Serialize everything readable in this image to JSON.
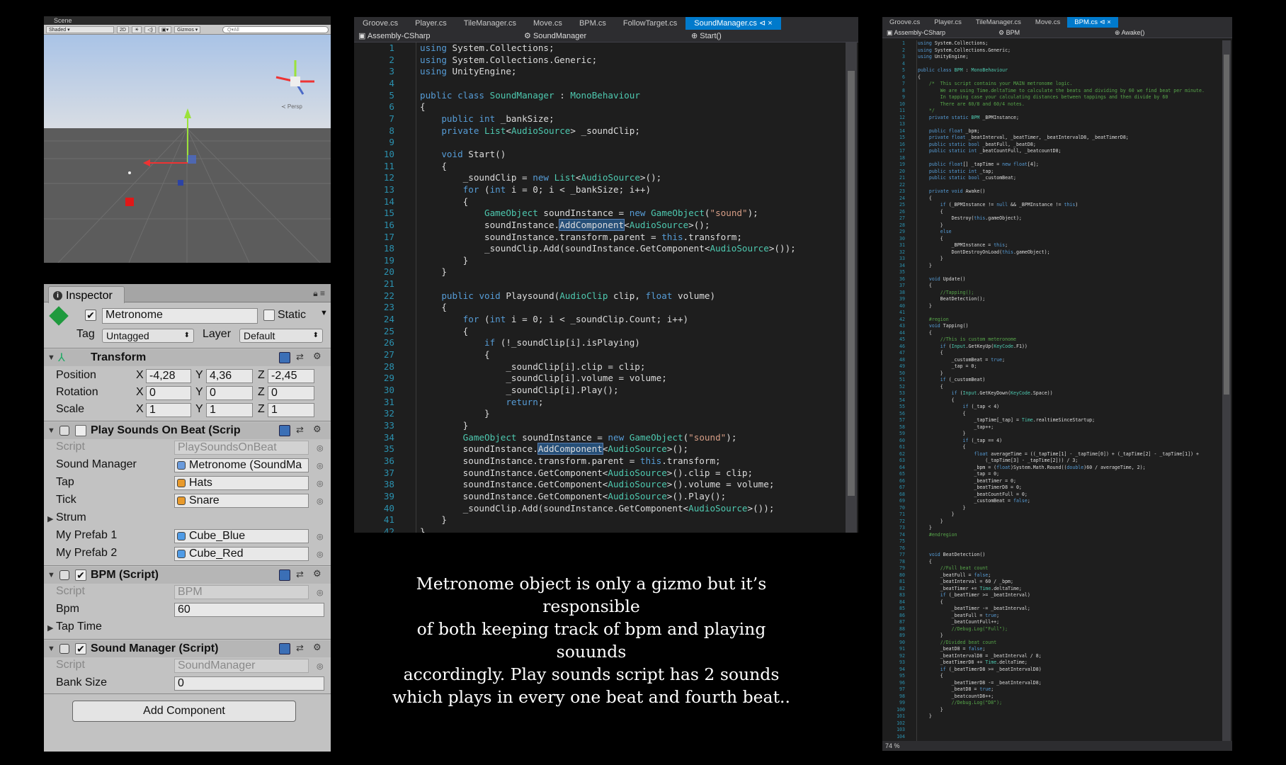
{
  "scene": {
    "tab": "Scene",
    "toolbar": {
      "shading": "Shaded",
      "mode2d": "2D",
      "gizmos": "Gizmos",
      "search_placeholder": "Q▾All"
    },
    "persp_label": "≺ Persp"
  },
  "inspector": {
    "tab": "Inspector",
    "object": {
      "name": "Metronome",
      "active": true,
      "static_label": "Static",
      "tag_label": "Tag",
      "tag": "Untagged",
      "layer_label": "Layer",
      "layer": "Default"
    },
    "transform": {
      "title": "Transform",
      "position": {
        "label": "Position",
        "x": "-4,28",
        "y": "4,36",
        "z": "-2,45"
      },
      "rotation": {
        "label": "Rotation",
        "x": "0",
        "y": "0",
        "z": "0"
      },
      "scale": {
        "label": "Scale",
        "x": "1",
        "y": "1",
        "z": "1"
      },
      "axis_x": "X",
      "axis_y": "Y",
      "axis_z": "Z"
    },
    "play_sounds": {
      "title": "Play Sounds On Beat (Scrip",
      "enabled": false,
      "script_label": "Script",
      "script": "PlaySoundsOnBeat",
      "sound_manager_label": "Sound Manager",
      "sound_manager": "Metronome (SoundMa",
      "tap_label": "Tap",
      "tap": "Hats",
      "tick_label": "Tick",
      "tick": "Snare",
      "strum_label": "Strum",
      "prefab1_label": "My Prefab 1",
      "prefab1": "Cube_Blue",
      "prefab2_label": "My Prefab 2",
      "prefab2": "Cube_Red"
    },
    "bpm": {
      "title": "BPM (Script)",
      "enabled": true,
      "script_label": "Script",
      "script": "BPM",
      "bpm_label": "Bpm",
      "bpm": "60",
      "tap_time_label": "Tap Time"
    },
    "sound_manager": {
      "title": "Sound Manager (Script)",
      "enabled": true,
      "script_label": "Script",
      "script": "SoundManager",
      "bank_size_label": "Bank Size",
      "bank_size": "0"
    },
    "add_component": "Add Component"
  },
  "editor1": {
    "tabs": [
      "Groove.cs",
      "Player.cs",
      "TileManager.cs",
      "Move.cs",
      "BPM.cs",
      "FollowTarget.cs",
      "SoundManager.cs"
    ],
    "active_tab": 6,
    "active_tab_extra": "⊲ ×",
    "nav": {
      "project": "Assembly-CSharp",
      "class": "SoundManager",
      "member": "Start()"
    },
    "first_line": 1,
    "lines": [
      "using System.Collections;",
      "using System.Collections.Generic;",
      "using UnityEngine;",
      "",
      "public class SoundManager : MonoBehaviour",
      "{",
      "    public int _bankSize;",
      "    private List<AudioSource> _soundClip;",
      "",
      "    void Start()",
      "    {",
      "        _soundClip = new List<AudioSource>();",
      "        for (int i = 0; i < _bankSize; i++)",
      "        {",
      "            GameObject soundInstance = new GameObject(\"sound\");",
      "            soundInstance.AddComponent<AudioSource>();",
      "            soundInstance.transform.parent = this.transform;",
      "            _soundClip.Add(soundInstance.GetComponent<AudioSource>());",
      "        }",
      "    }",
      "",
      "    public void Playsound(AudioClip clip, float volume)",
      "    {",
      "        for (int i = 0; i < _soundClip.Count; i++)",
      "        {",
      "            if (!_soundClip[i].isPlaying)",
      "            {",
      "                _soundClip[i].clip = clip;",
      "                _soundClip[i].volume = volume;",
      "                _soundClip[i].Play();",
      "                return;",
      "            }",
      "        }",
      "        GameObject soundInstance = new GameObject(\"sound\");",
      "        soundInstance.AddComponent<AudioSource>();",
      "        soundInstance.transform.parent = this.transform;",
      "        soundInstance.GetComponent<AudioSource>().clip = clip;",
      "        soundInstance.GetComponent<AudioSource>().volume = volume;",
      "        soundInstance.GetComponent<AudioSource>().Play();",
      "        _soundClip.Add(soundInstance.GetComponent<AudioSource>());",
      "    }",
      "}"
    ]
  },
  "editor2": {
    "tabs": [
      "Groove.cs",
      "Player.cs",
      "TileManager.cs",
      "Move.cs",
      "BPM.cs"
    ],
    "active_tab": 4,
    "active_tab_extra": "⊲ ×",
    "nav": {
      "project": "Assembly-CSharp",
      "class": "BPM",
      "member": "Awake()"
    },
    "zoom": "74 %",
    "first_line": 1,
    "lines": [
      "using System.Collections;",
      "using System.Collections.Generic;",
      "using UnityEngine;",
      "",
      "public class BPM : MonoBehaviour",
      "{",
      "    /*  This script contains your MAIN metronome logic.",
      "        We are using Time.deltaTime to calculate the beats and dividing by 60 we find beat per minute.",
      "        In tapping case your calculating distances between tappings and then divide by 60",
      "        There are 60/8 and 60/4 notes.",
      "    */",
      "    private static BPM _BPMInstance;",
      "",
      "    public float _bpm;",
      "    private float _beatInterval, _beatTimer, _beatIntervalD8, _beatTimerD8;",
      "    public static bool _beatFull, _beatD8;",
      "    public static int _beatCountFull, _beatcountD8;",
      "",
      "    public float[] _tapTime = new float[4];",
      "    public static int _tap;",
      "    public static bool _customBeat;",
      "",
      "    private void Awake()",
      "    {",
      "        if (_BPMInstance != null && _BPMInstance != this)",
      "        {",
      "            Destroy(this.gameObject);",
      "        }",
      "        else",
      "        {",
      "            _BPMInstance = this;",
      "            DontDestroyOnLoad(this.gameObject);",
      "        }",
      "    }",
      "",
      "    void Update()",
      "    {",
      "        //Tapping();",
      "        BeatDetection();",
      "    }",
      "",
      "    #region",
      "    void Tapping()",
      "    {",
      "        //This is custom meteronome",
      "        if (Input.GetKeyUp(KeyCode.F1))",
      "        {",
      "            _customBeat = true;",
      "            _tap = 0;",
      "        }",
      "        if (_customBeat)",
      "        {",
      "            if (Input.GetKeyDown(KeyCode.Space))",
      "            {",
      "                if (_tap < 4)",
      "                {",
      "                    _tapTime[_tap] = Time.realtimeSinceStartup;",
      "                    _tap++;",
      "                }",
      "                if (_tap == 4)",
      "                {",
      "                    float averageTime = ((_tapTime[1] - _tapTime[0]) + (_tapTime[2] - _tapTime[1]) +",
      "                        (_tapTime[3] - _tapTime[2])) / 3;",
      "                    _bpm = (float)System.Math.Round((double)60 / averageTime, 2);",
      "                    _tap = 0;",
      "                    _beatTimer = 0;",
      "                    _beatTimerD8 = 0;",
      "                    _beatCountFull = 0;",
      "                    _customBeat = false;",
      "                }",
      "            }",
      "        }",
      "    }",
      "    #endregion",
      "",
      "",
      "    void BeatDetection()",
      "    {",
      "        //Full beat count",
      "        _beatFull = false;",
      "        _beatInterval = 60 / _bpm;",
      "        _beatTimer += Time.deltaTime;",
      "        if (_beatTimer >= _beatInterval)",
      "        {",
      "            _beatTimer -= _beatInterval;",
      "            _beatFull = true;",
      "            _beatCountFull++;",
      "            //Debug.Log(\"Full\");",
      "        }",
      "        //Divided beat count",
      "        _beatD8 = false;",
      "        _beatIntervalD8 = _beatInterval / 8;",
      "        _beatTimerD8 += Time.deltaTime;",
      "        if (_beatTimerD8 >= _beatIntervalD8)",
      "        {",
      "            _beatTimerD8 -= _beatIntervalD8;",
      "            _beatD8 = true;",
      "            _beatcountD8++;",
      "            //Debug.Log(\"D8\");",
      "        }",
      "    }",
      "",
      "",
      "",
      "",
      "}"
    ]
  },
  "caption": [
    "Metronome object is only a gizmo but it’s responsible",
    "of both keeping track of bpm and playing souunds",
    "accordingly. Play sounds script has 2 sounds",
    "which plays in every one beat and fourth beat.."
  ],
  "colors": {
    "editor_bg": "#1e1e1e",
    "keyword": "#569cd6",
    "type": "#4ec9b0",
    "string": "#d69d85",
    "comment": "#57a64a",
    "line_number": "#2b91af",
    "active_tab": "#007acc",
    "inspector_bg": "#c2c2c2",
    "scene_bg": "#5a5a5a"
  }
}
